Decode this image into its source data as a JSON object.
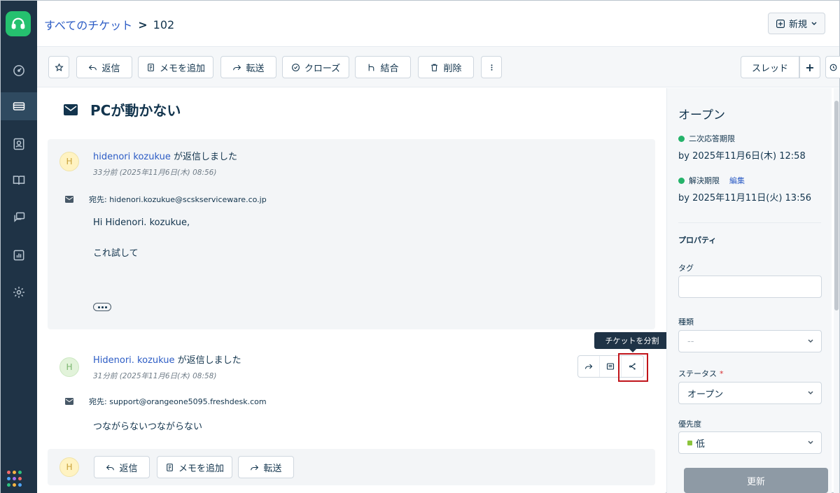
{
  "nav": {
    "icons": [
      "headset-logo-icon",
      "dashboard-icon",
      "tickets-icon",
      "contacts-icon",
      "knowledge-base-icon",
      "discussions-icon",
      "reports-icon",
      "settings-icon",
      "app-grid-icon"
    ],
    "active": "tickets-icon",
    "brand_color": "#25c16f",
    "bg_color": "#1f3346"
  },
  "header": {
    "breadcrumb_parent": "すべてのチケット",
    "breadcrumb_sep": ">",
    "ticket_id": "102",
    "new_button": "新規"
  },
  "toolbar": {
    "reply": "返信",
    "add_note": "メモを追加",
    "forward": "転送",
    "close": "クローズ",
    "merge": "結合",
    "delete": "削除",
    "thread": "スレッド",
    "plus": "+"
  },
  "ticket": {
    "subject": "PCが動かない"
  },
  "conversations": [
    {
      "avatar": "H",
      "author": "hidenori kozukue",
      "action": "が返信しました",
      "time": "33分前 (2025年11月6日(木) 08:56)",
      "to_label": "宛先:",
      "to": "hidenori.kozukue@scskserviceware.co.jp",
      "greeting": "Hi Hidenori. kozukue,",
      "body": "これ試して"
    },
    {
      "avatar": "H",
      "author": "Hidenori. kozukue",
      "action": "が返信しました",
      "time": "31分前 (2025年11月6日(木) 08:58)",
      "to_label": "宛先:",
      "to": "support@orangeone5095.freshdesk.com",
      "body": "つながらないつながらない"
    }
  ],
  "message_actions": {
    "tooltip": "チケットを分割",
    "icons": [
      "forward-icon",
      "note-icon",
      "split-ticket-icon"
    ]
  },
  "reply_bar": {
    "avatar": "H",
    "reply": "返信",
    "add_note": "メモを追加",
    "forward": "転送"
  },
  "sidebar": {
    "status_title": "オープン",
    "first_response_label": "二次応答期限",
    "first_response_date": "by 2025年11月6日(木) 12:58",
    "resolution_label": "解決期限",
    "resolution_edit": "編集",
    "resolution_date": "by 2025年11月11日(火) 13:56",
    "properties_heading": "プロパティ",
    "tags_label": "タグ",
    "tags_value": "",
    "type_label": "種類",
    "type_value": "--",
    "status_label": "ステータス",
    "status_required": "*",
    "status_value": "オープン",
    "priority_label": "優先度",
    "priority_value": "低",
    "update_button": "更新",
    "sla_color": "#25b36a",
    "priority_color": "#8cc43c"
  }
}
